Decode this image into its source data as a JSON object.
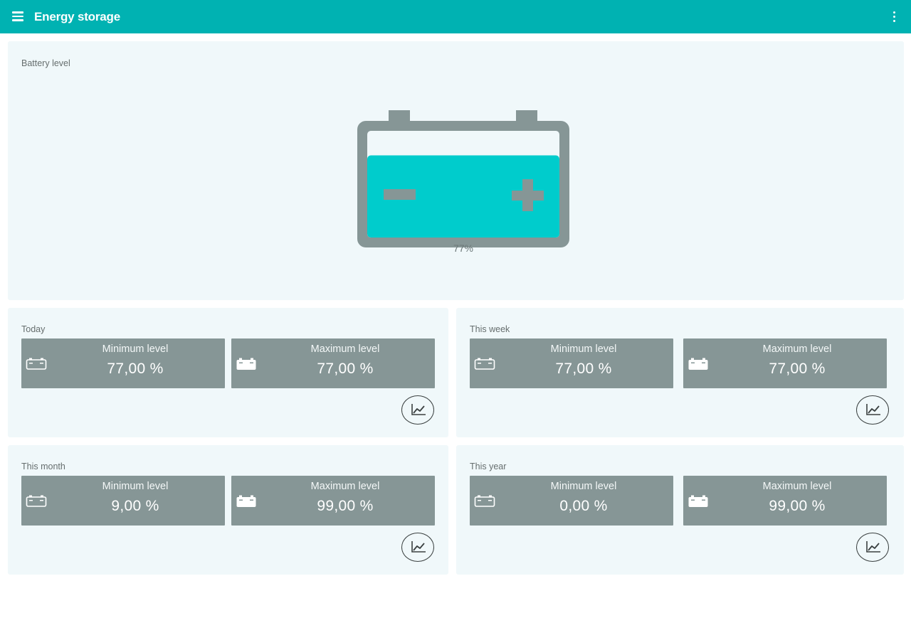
{
  "app_bar": {
    "title": "Energy storage",
    "menu_icon": "hamburger-menu-icon",
    "overflow_icon": "more-vert-icon"
  },
  "colors": {
    "app_bar": "#00b2b2",
    "battery_fill": "#00cccc",
    "battery_frame": "#869696",
    "tile_bg": "#869696",
    "card_bg": "#f0f8fa"
  },
  "battery": {
    "title": "Battery level",
    "level_percent": 77,
    "level_label": "77%"
  },
  "periods": [
    {
      "title": "Today",
      "min_label": "Minimum level",
      "min_value": "77,00 %",
      "max_label": "Maximum level",
      "max_value": "77,00 %"
    },
    {
      "title": "This week",
      "min_label": "Minimum level",
      "min_value": "77,00 %",
      "max_label": "Maximum level",
      "max_value": "77,00 %"
    },
    {
      "title": "This month",
      "min_label": "Minimum level",
      "min_value": "9,00 %",
      "max_label": "Maximum level",
      "max_value": "99,00 %"
    },
    {
      "title": "This year",
      "min_label": "Minimum level",
      "min_value": "0,00 %",
      "max_label": "Maximum level",
      "max_value": "99,00 %"
    }
  ]
}
